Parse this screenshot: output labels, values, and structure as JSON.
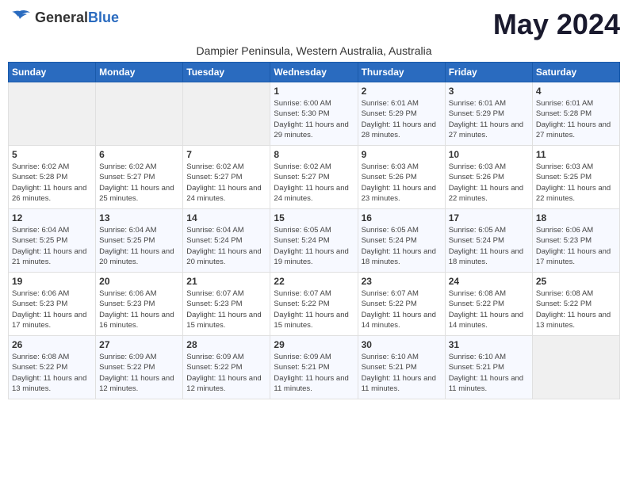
{
  "logo": {
    "general": "General",
    "blue": "Blue"
  },
  "title": "May 2024",
  "subtitle": "Dampier Peninsula, Western Australia, Australia",
  "header_days": [
    "Sunday",
    "Monday",
    "Tuesday",
    "Wednesday",
    "Thursday",
    "Friday",
    "Saturday"
  ],
  "weeks": [
    {
      "days": [
        {
          "num": "",
          "info": ""
        },
        {
          "num": "",
          "info": ""
        },
        {
          "num": "",
          "info": ""
        },
        {
          "num": "1",
          "info": "Sunrise: 6:00 AM\nSunset: 5:30 PM\nDaylight: 11 hours and 29 minutes."
        },
        {
          "num": "2",
          "info": "Sunrise: 6:01 AM\nSunset: 5:29 PM\nDaylight: 11 hours and 28 minutes."
        },
        {
          "num": "3",
          "info": "Sunrise: 6:01 AM\nSunset: 5:29 PM\nDaylight: 11 hours and 27 minutes."
        },
        {
          "num": "4",
          "info": "Sunrise: 6:01 AM\nSunset: 5:28 PM\nDaylight: 11 hours and 27 minutes."
        }
      ]
    },
    {
      "days": [
        {
          "num": "5",
          "info": "Sunrise: 6:02 AM\nSunset: 5:28 PM\nDaylight: 11 hours and 26 minutes."
        },
        {
          "num": "6",
          "info": "Sunrise: 6:02 AM\nSunset: 5:27 PM\nDaylight: 11 hours and 25 minutes."
        },
        {
          "num": "7",
          "info": "Sunrise: 6:02 AM\nSunset: 5:27 PM\nDaylight: 11 hours and 24 minutes."
        },
        {
          "num": "8",
          "info": "Sunrise: 6:02 AM\nSunset: 5:27 PM\nDaylight: 11 hours and 24 minutes."
        },
        {
          "num": "9",
          "info": "Sunrise: 6:03 AM\nSunset: 5:26 PM\nDaylight: 11 hours and 23 minutes."
        },
        {
          "num": "10",
          "info": "Sunrise: 6:03 AM\nSunset: 5:26 PM\nDaylight: 11 hours and 22 minutes."
        },
        {
          "num": "11",
          "info": "Sunrise: 6:03 AM\nSunset: 5:25 PM\nDaylight: 11 hours and 22 minutes."
        }
      ]
    },
    {
      "days": [
        {
          "num": "12",
          "info": "Sunrise: 6:04 AM\nSunset: 5:25 PM\nDaylight: 11 hours and 21 minutes."
        },
        {
          "num": "13",
          "info": "Sunrise: 6:04 AM\nSunset: 5:25 PM\nDaylight: 11 hours and 20 minutes."
        },
        {
          "num": "14",
          "info": "Sunrise: 6:04 AM\nSunset: 5:24 PM\nDaylight: 11 hours and 20 minutes."
        },
        {
          "num": "15",
          "info": "Sunrise: 6:05 AM\nSunset: 5:24 PM\nDaylight: 11 hours and 19 minutes."
        },
        {
          "num": "16",
          "info": "Sunrise: 6:05 AM\nSunset: 5:24 PM\nDaylight: 11 hours and 18 minutes."
        },
        {
          "num": "17",
          "info": "Sunrise: 6:05 AM\nSunset: 5:24 PM\nDaylight: 11 hours and 18 minutes."
        },
        {
          "num": "18",
          "info": "Sunrise: 6:06 AM\nSunset: 5:23 PM\nDaylight: 11 hours and 17 minutes."
        }
      ]
    },
    {
      "days": [
        {
          "num": "19",
          "info": "Sunrise: 6:06 AM\nSunset: 5:23 PM\nDaylight: 11 hours and 17 minutes."
        },
        {
          "num": "20",
          "info": "Sunrise: 6:06 AM\nSunset: 5:23 PM\nDaylight: 11 hours and 16 minutes."
        },
        {
          "num": "21",
          "info": "Sunrise: 6:07 AM\nSunset: 5:23 PM\nDaylight: 11 hours and 15 minutes."
        },
        {
          "num": "22",
          "info": "Sunrise: 6:07 AM\nSunset: 5:22 PM\nDaylight: 11 hours and 15 minutes."
        },
        {
          "num": "23",
          "info": "Sunrise: 6:07 AM\nSunset: 5:22 PM\nDaylight: 11 hours and 14 minutes."
        },
        {
          "num": "24",
          "info": "Sunrise: 6:08 AM\nSunset: 5:22 PM\nDaylight: 11 hours and 14 minutes."
        },
        {
          "num": "25",
          "info": "Sunrise: 6:08 AM\nSunset: 5:22 PM\nDaylight: 11 hours and 13 minutes."
        }
      ]
    },
    {
      "days": [
        {
          "num": "26",
          "info": "Sunrise: 6:08 AM\nSunset: 5:22 PM\nDaylight: 11 hours and 13 minutes."
        },
        {
          "num": "27",
          "info": "Sunrise: 6:09 AM\nSunset: 5:22 PM\nDaylight: 11 hours and 12 minutes."
        },
        {
          "num": "28",
          "info": "Sunrise: 6:09 AM\nSunset: 5:22 PM\nDaylight: 11 hours and 12 minutes."
        },
        {
          "num": "29",
          "info": "Sunrise: 6:09 AM\nSunset: 5:21 PM\nDaylight: 11 hours and 11 minutes."
        },
        {
          "num": "30",
          "info": "Sunrise: 6:10 AM\nSunset: 5:21 PM\nDaylight: 11 hours and 11 minutes."
        },
        {
          "num": "31",
          "info": "Sunrise: 6:10 AM\nSunset: 5:21 PM\nDaylight: 11 hours and 11 minutes."
        },
        {
          "num": "",
          "info": ""
        }
      ]
    }
  ]
}
